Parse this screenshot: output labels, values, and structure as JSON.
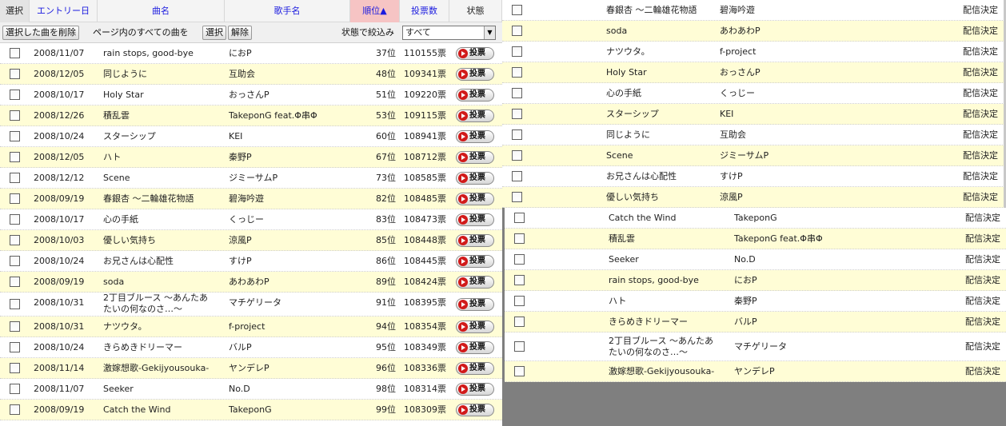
{
  "header": {
    "select": "選択",
    "entry_date": "エントリー日",
    "song": "曲名",
    "artist": "歌手名",
    "rank": "順位▲",
    "votes": "投票数",
    "status": "状態"
  },
  "toolbar": {
    "delete_selected": "選択した曲を削除",
    "all_songs_label": "ページ内のすべての曲を",
    "select_btn": "選択",
    "clear_btn": "解除",
    "filter_label": "状態で絞込み",
    "filter_value": "すべて"
  },
  "vote_label": "投票",
  "left_rows": [
    {
      "date": "2008/11/07",
      "song": "rain stops, good-bye",
      "artist": "におP",
      "rank": "37位",
      "votes": "110155票"
    },
    {
      "date": "2008/12/05",
      "song": "同じように",
      "artist": "互助会",
      "rank": "48位",
      "votes": "109341票"
    },
    {
      "date": "2008/10/17",
      "song": "Holy Star",
      "artist": "おっさんP",
      "rank": "51位",
      "votes": "109220票"
    },
    {
      "date": "2008/12/26",
      "song": "積乱雲",
      "artist": "TakeponG feat.Φ串Φ",
      "rank": "53位",
      "votes": "109115票"
    },
    {
      "date": "2008/10/24",
      "song": "スターシップ",
      "artist": "KEI",
      "rank": "60位",
      "votes": "108941票"
    },
    {
      "date": "2008/12/05",
      "song": "ハト",
      "artist": "秦野P",
      "rank": "67位",
      "votes": "108712票"
    },
    {
      "date": "2008/12/12",
      "song": "Scene",
      "artist": "ジミーサムP",
      "rank": "73位",
      "votes": "108585票"
    },
    {
      "date": "2008/09/19",
      "song": "春銀杏 ～二輪雄花物語",
      "artist": "碧海吟遊",
      "rank": "82位",
      "votes": "108485票"
    },
    {
      "date": "2008/10/17",
      "song": "心の手紙",
      "artist": "くっじー",
      "rank": "83位",
      "votes": "108473票"
    },
    {
      "date": "2008/10/03",
      "song": "優しい気持ち",
      "artist": "涼風P",
      "rank": "85位",
      "votes": "108448票"
    },
    {
      "date": "2008/10/24",
      "song": "お兄さんは心配性",
      "artist": "すけP",
      "rank": "86位",
      "votes": "108445票"
    },
    {
      "date": "2008/09/19",
      "song": "soda",
      "artist": "あわあわP",
      "rank": "89位",
      "votes": "108424票"
    },
    {
      "date": "2008/10/31",
      "song": "2丁目ブルース ～あんたあ",
      "song2": "たいの何なのさ…～",
      "artist": "マチゲリータ",
      "rank": "91位",
      "votes": "108395票"
    },
    {
      "date": "2008/10/31",
      "song": "ナツウタ。",
      "artist": "f-project",
      "rank": "94位",
      "votes": "108354票"
    },
    {
      "date": "2008/10/24",
      "song": "きらめきドリーマー",
      "artist": "バルP",
      "rank": "95位",
      "votes": "108349票"
    },
    {
      "date": "2008/11/14",
      "song": "激嫁想歌-Gekijyousouka-",
      "artist": "ヤンデレP",
      "rank": "96位",
      "votes": "108336票"
    },
    {
      "date": "2008/11/07",
      "song": "Seeker",
      "artist": "No.D",
      "rank": "98位",
      "votes": "108314票"
    },
    {
      "date": "2008/09/19",
      "song": "Catch the Wind",
      "artist": "TakeponG",
      "rank": "99位",
      "votes": "108309票"
    }
  ],
  "right_top_rows": [
    {
      "song": "春銀杏 ～二輪雄花物語",
      "artist": "碧海吟遊",
      "status": "配信決定"
    },
    {
      "song": "soda",
      "artist": "あわあわP",
      "status": "配信決定"
    },
    {
      "song": "ナツウタ。",
      "artist": "f-project",
      "status": "配信決定"
    },
    {
      "song": "Holy Star",
      "artist": "おっさんP",
      "status": "配信決定"
    },
    {
      "song": "心の手紙",
      "artist": "くっじー",
      "status": "配信決定"
    },
    {
      "song": "スターシップ",
      "artist": "KEI",
      "status": "配信決定"
    },
    {
      "song": "同じように",
      "artist": "互助会",
      "status": "配信決定"
    },
    {
      "song": "Scene",
      "artist": "ジミーサムP",
      "status": "配信決定"
    },
    {
      "song": "お兄さんは心配性",
      "artist": "すけP",
      "status": "配信決定"
    },
    {
      "song": "優しい気持ち",
      "artist": "涼風P",
      "status": "配信決定"
    }
  ],
  "right_bottom_rows": [
    {
      "song": "Catch the Wind",
      "artist": "TakeponG",
      "status": "配信決定"
    },
    {
      "song": "積乱雲",
      "artist": "TakeponG feat.Φ串Φ",
      "status": "配信決定"
    },
    {
      "song": "Seeker",
      "artist": "No.D",
      "status": "配信決定"
    },
    {
      "song": "rain stops, good-bye",
      "artist": "におP",
      "status": "配信決定"
    },
    {
      "song": "ハト",
      "artist": "秦野P",
      "status": "配信決定"
    },
    {
      "song": "きらめきドリーマー",
      "artist": "バルP",
      "status": "配信決定"
    },
    {
      "song": "2丁目ブルース ～あんたあ",
      "song2": "たいの何なのさ…～",
      "artist": "マチゲリータ",
      "status": "配信決定"
    },
    {
      "song": "激嫁想歌-Gekijyousouka-",
      "artist": "ヤンデレP",
      "status": "配信決定"
    }
  ]
}
